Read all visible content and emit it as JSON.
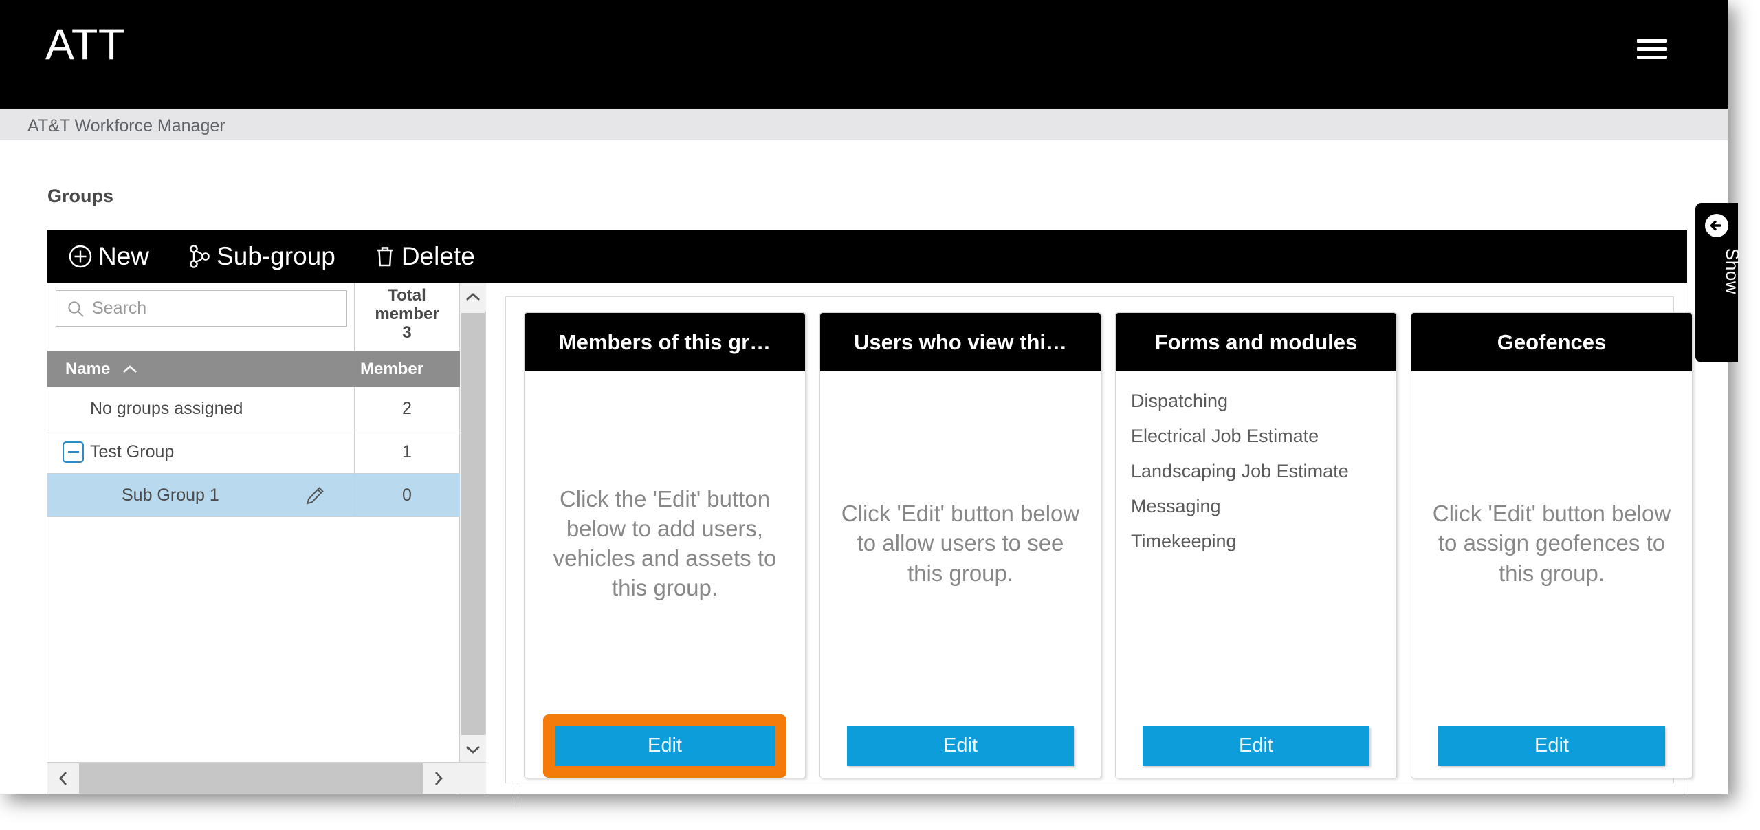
{
  "header": {
    "brand": "ATT",
    "menu_icon": "hamburger-icon"
  },
  "subheader": {
    "title": "AT&T Workforce Manager"
  },
  "page": {
    "title": "Groups"
  },
  "toolbar": {
    "buttons": [
      {
        "label": "New",
        "icon": "plus-circle-icon"
      },
      {
        "label": "Sub-group",
        "icon": "branch-icon"
      },
      {
        "label": "Delete",
        "icon": "trash-icon"
      }
    ]
  },
  "grid": {
    "search_placeholder": "Search",
    "search_value": "",
    "total_label_line1": "Total",
    "total_label_line2": "member",
    "total_value": "3",
    "columns": [
      "Name",
      "Member"
    ],
    "sort_indicator": "caret-up-icon",
    "rows": [
      {
        "name": "No groups assigned",
        "members": "2",
        "indent": 1,
        "expander": false,
        "pencil": false,
        "selected": false
      },
      {
        "name": "Test Group",
        "members": "1",
        "indent": 1,
        "expander": true,
        "pencil": false,
        "selected": false
      },
      {
        "name": "Sub Group 1",
        "members": "0",
        "indent": 2,
        "expander": false,
        "pencil": true,
        "selected": true
      }
    ]
  },
  "cards": [
    {
      "title": "Members of this gr…",
      "hint": "Click the 'Edit' button below to add users, vehicles and assets to this group.",
      "items": [],
      "edit_label": "Edit",
      "highlighted": true
    },
    {
      "title": "Users who view thi…",
      "hint": "Click 'Edit' button below to allow users to see this group.",
      "items": [],
      "edit_label": "Edit",
      "highlighted": false
    },
    {
      "title": "Forms and modules",
      "hint": "",
      "items": [
        "Dispatching",
        "Electrical Job Estimate",
        "Landscaping Job Estimate",
        "Messaging",
        "Timekeeping"
      ],
      "edit_label": "Edit",
      "highlighted": false
    },
    {
      "title": "Geofences",
      "hint": "Click 'Edit' button below to assign geofences to this group.",
      "items": [],
      "edit_label": "Edit",
      "highlighted": false
    }
  ],
  "side_tab": {
    "label": "Show",
    "icon": "arrow-left-circle-icon"
  },
  "colors": {
    "accent_blue": "#0d9ddb",
    "highlight_orange": "#f47b0a",
    "header_black": "#000000",
    "row_selected": "#b9d9ef",
    "grid_header_gray": "#8d8d8d"
  }
}
